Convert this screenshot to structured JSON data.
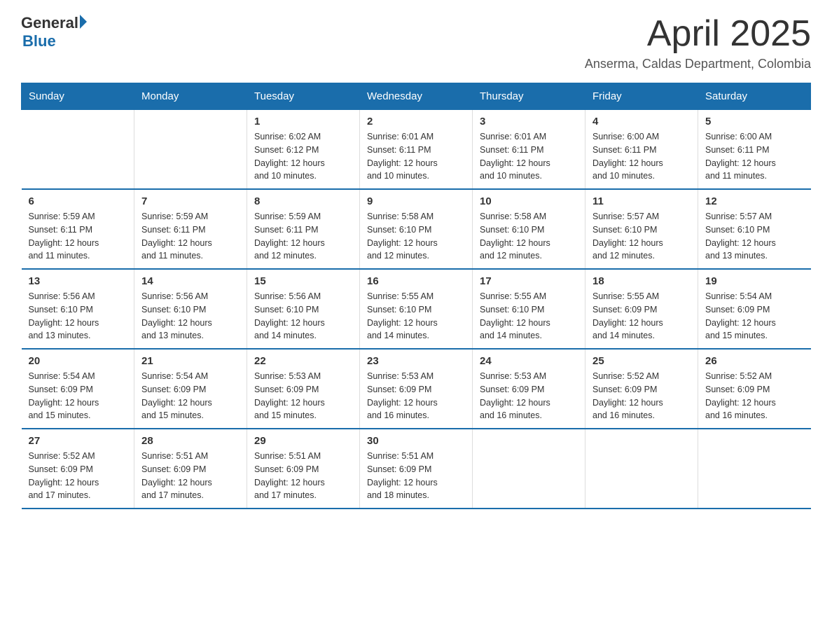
{
  "logo": {
    "general": "General",
    "triangle": "▶",
    "blue": "Blue"
  },
  "title": "April 2025",
  "subtitle": "Anserma, Caldas Department, Colombia",
  "days_header": [
    "Sunday",
    "Monday",
    "Tuesday",
    "Wednesday",
    "Thursday",
    "Friday",
    "Saturday"
  ],
  "weeks": [
    [
      {
        "day": "",
        "info": ""
      },
      {
        "day": "",
        "info": ""
      },
      {
        "day": "1",
        "info": "Sunrise: 6:02 AM\nSunset: 6:12 PM\nDaylight: 12 hours\nand 10 minutes."
      },
      {
        "day": "2",
        "info": "Sunrise: 6:01 AM\nSunset: 6:11 PM\nDaylight: 12 hours\nand 10 minutes."
      },
      {
        "day": "3",
        "info": "Sunrise: 6:01 AM\nSunset: 6:11 PM\nDaylight: 12 hours\nand 10 minutes."
      },
      {
        "day": "4",
        "info": "Sunrise: 6:00 AM\nSunset: 6:11 PM\nDaylight: 12 hours\nand 10 minutes."
      },
      {
        "day": "5",
        "info": "Sunrise: 6:00 AM\nSunset: 6:11 PM\nDaylight: 12 hours\nand 11 minutes."
      }
    ],
    [
      {
        "day": "6",
        "info": "Sunrise: 5:59 AM\nSunset: 6:11 PM\nDaylight: 12 hours\nand 11 minutes."
      },
      {
        "day": "7",
        "info": "Sunrise: 5:59 AM\nSunset: 6:11 PM\nDaylight: 12 hours\nand 11 minutes."
      },
      {
        "day": "8",
        "info": "Sunrise: 5:59 AM\nSunset: 6:11 PM\nDaylight: 12 hours\nand 12 minutes."
      },
      {
        "day": "9",
        "info": "Sunrise: 5:58 AM\nSunset: 6:10 PM\nDaylight: 12 hours\nand 12 minutes."
      },
      {
        "day": "10",
        "info": "Sunrise: 5:58 AM\nSunset: 6:10 PM\nDaylight: 12 hours\nand 12 minutes."
      },
      {
        "day": "11",
        "info": "Sunrise: 5:57 AM\nSunset: 6:10 PM\nDaylight: 12 hours\nand 12 minutes."
      },
      {
        "day": "12",
        "info": "Sunrise: 5:57 AM\nSunset: 6:10 PM\nDaylight: 12 hours\nand 13 minutes."
      }
    ],
    [
      {
        "day": "13",
        "info": "Sunrise: 5:56 AM\nSunset: 6:10 PM\nDaylight: 12 hours\nand 13 minutes."
      },
      {
        "day": "14",
        "info": "Sunrise: 5:56 AM\nSunset: 6:10 PM\nDaylight: 12 hours\nand 13 minutes."
      },
      {
        "day": "15",
        "info": "Sunrise: 5:56 AM\nSunset: 6:10 PM\nDaylight: 12 hours\nand 14 minutes."
      },
      {
        "day": "16",
        "info": "Sunrise: 5:55 AM\nSunset: 6:10 PM\nDaylight: 12 hours\nand 14 minutes."
      },
      {
        "day": "17",
        "info": "Sunrise: 5:55 AM\nSunset: 6:10 PM\nDaylight: 12 hours\nand 14 minutes."
      },
      {
        "day": "18",
        "info": "Sunrise: 5:55 AM\nSunset: 6:09 PM\nDaylight: 12 hours\nand 14 minutes."
      },
      {
        "day": "19",
        "info": "Sunrise: 5:54 AM\nSunset: 6:09 PM\nDaylight: 12 hours\nand 15 minutes."
      }
    ],
    [
      {
        "day": "20",
        "info": "Sunrise: 5:54 AM\nSunset: 6:09 PM\nDaylight: 12 hours\nand 15 minutes."
      },
      {
        "day": "21",
        "info": "Sunrise: 5:54 AM\nSunset: 6:09 PM\nDaylight: 12 hours\nand 15 minutes."
      },
      {
        "day": "22",
        "info": "Sunrise: 5:53 AM\nSunset: 6:09 PM\nDaylight: 12 hours\nand 15 minutes."
      },
      {
        "day": "23",
        "info": "Sunrise: 5:53 AM\nSunset: 6:09 PM\nDaylight: 12 hours\nand 16 minutes."
      },
      {
        "day": "24",
        "info": "Sunrise: 5:53 AM\nSunset: 6:09 PM\nDaylight: 12 hours\nand 16 minutes."
      },
      {
        "day": "25",
        "info": "Sunrise: 5:52 AM\nSunset: 6:09 PM\nDaylight: 12 hours\nand 16 minutes."
      },
      {
        "day": "26",
        "info": "Sunrise: 5:52 AM\nSunset: 6:09 PM\nDaylight: 12 hours\nand 16 minutes."
      }
    ],
    [
      {
        "day": "27",
        "info": "Sunrise: 5:52 AM\nSunset: 6:09 PM\nDaylight: 12 hours\nand 17 minutes."
      },
      {
        "day": "28",
        "info": "Sunrise: 5:51 AM\nSunset: 6:09 PM\nDaylight: 12 hours\nand 17 minutes."
      },
      {
        "day": "29",
        "info": "Sunrise: 5:51 AM\nSunset: 6:09 PM\nDaylight: 12 hours\nand 17 minutes."
      },
      {
        "day": "30",
        "info": "Sunrise: 5:51 AM\nSunset: 6:09 PM\nDaylight: 12 hours\nand 18 minutes."
      },
      {
        "day": "",
        "info": ""
      },
      {
        "day": "",
        "info": ""
      },
      {
        "day": "",
        "info": ""
      }
    ]
  ]
}
